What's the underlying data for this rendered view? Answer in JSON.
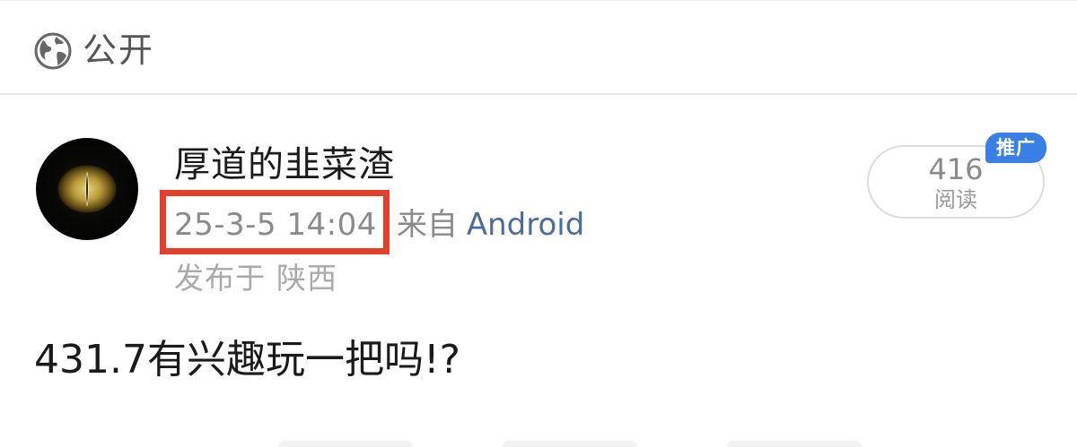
{
  "visibility": {
    "icon": "globe-icon",
    "label": "公开"
  },
  "author": {
    "name": "厚道的韭菜渣",
    "avatar": "cat-eye-avatar"
  },
  "meta": {
    "timestamp": "25-3-5 14:04",
    "source_prefix": "来自",
    "source_app": "Android",
    "location_prefix": "发布于",
    "location": "陕西"
  },
  "stats": {
    "read_count": "416",
    "read_label": "阅读",
    "promo_label": "推广"
  },
  "post": {
    "text": "431.7有兴趣玩一把吗!?"
  },
  "colors": {
    "highlight": "#e3402b",
    "link": "#4d6b98",
    "badge": "#3a7fe6"
  }
}
